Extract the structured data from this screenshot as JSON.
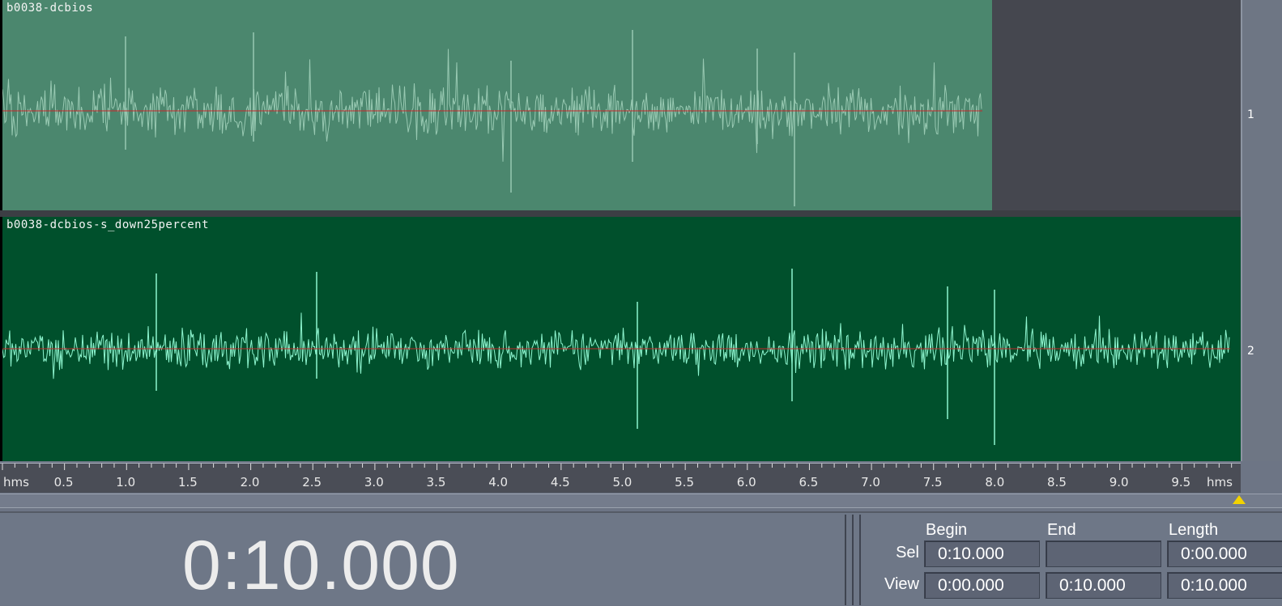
{
  "tracks": [
    {
      "name": "b0038-dcbios",
      "channel": "1"
    },
    {
      "name": "b0038-dcbios-s_down25percent",
      "channel": "2"
    }
  ],
  "ruler": {
    "unit_left": "hms",
    "unit_right": "hms",
    "ticks": [
      "0.5",
      "1.0",
      "1.5",
      "2.0",
      "2.5",
      "3.0",
      "3.5",
      "4.0",
      "4.5",
      "5.0",
      "5.5",
      "6.0",
      "6.5",
      "7.0",
      "7.5",
      "8.0",
      "8.5",
      "9.0",
      "9.5"
    ]
  },
  "time_display": "0:10.000",
  "selection_panel": {
    "headers": {
      "begin": "Begin",
      "end": "End",
      "length": "Length"
    },
    "sel": {
      "label": "Sel",
      "begin": "0:10.000",
      "end": "",
      "length": "0:00.000"
    },
    "view": {
      "label": "View",
      "begin": "0:00.000",
      "end": "0:10.000",
      "length": "0:10.000"
    }
  },
  "colors": {
    "track1_bg": "#4b876e",
    "track1_wave": "#98c9b2",
    "track2_bg": "#00502c",
    "track2_wave": "#8ef5cf",
    "center_line": "#c8262a",
    "playhead": "#f2d200"
  },
  "icons": {
    "playhead_marker": "triangle-up"
  }
}
